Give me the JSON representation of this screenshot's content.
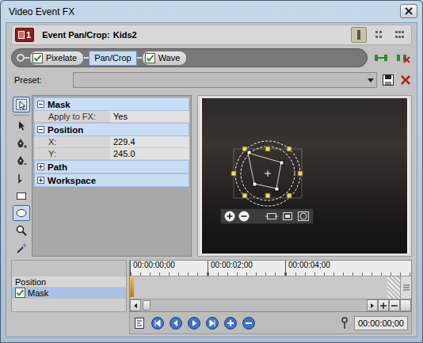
{
  "window": {
    "title": "Video Event FX"
  },
  "header": {
    "badge": "1",
    "label": "Event Pan/Crop:",
    "event": "Kids2",
    "views": [
      {
        "selected": true
      },
      {
        "selected": false
      },
      {
        "selected": false
      }
    ]
  },
  "chain": [
    {
      "label": "Pixelate",
      "kind": "checkbox",
      "checked": true,
      "selected": false
    },
    {
      "label": "Pan/Crop",
      "kind": "plain",
      "selected": true
    },
    {
      "label": "Wave",
      "kind": "checkbox",
      "checked": true,
      "selected": false
    }
  ],
  "preset": {
    "label": "Preset:",
    "value": ""
  },
  "tools": [
    {
      "selected": true
    },
    {
      "selected": false
    },
    {
      "selected": false
    },
    {
      "selected": false
    },
    {
      "selected": false
    },
    {
      "selected": false
    },
    {
      "selected": true
    },
    {
      "selected": false
    },
    {
      "selected": false
    }
  ],
  "properties": [
    {
      "title": "Mask",
      "expanded": true,
      "rows": [
        {
          "label": "Apply to FX:",
          "value": "Yes"
        }
      ]
    },
    {
      "title": "Position",
      "expanded": true,
      "rows": [
        {
          "label": "X:",
          "value": "229.4"
        },
        {
          "label": "Y:",
          "value": "245.0"
        }
      ]
    },
    {
      "title": "Path",
      "expanded": false,
      "rows": []
    },
    {
      "title": "Workspace",
      "expanded": false,
      "rows": []
    }
  ],
  "timeline": {
    "ruler": [
      "00:00:00;00",
      "00:00:02;00",
      "00:00:04;00"
    ],
    "tracks": [
      {
        "label": "Position",
        "kind": "plain",
        "selected": false
      },
      {
        "label": "Mask",
        "kind": "checkbox",
        "checked": true,
        "selected": true
      }
    ],
    "cursor_time": "00:00:00;00"
  }
}
